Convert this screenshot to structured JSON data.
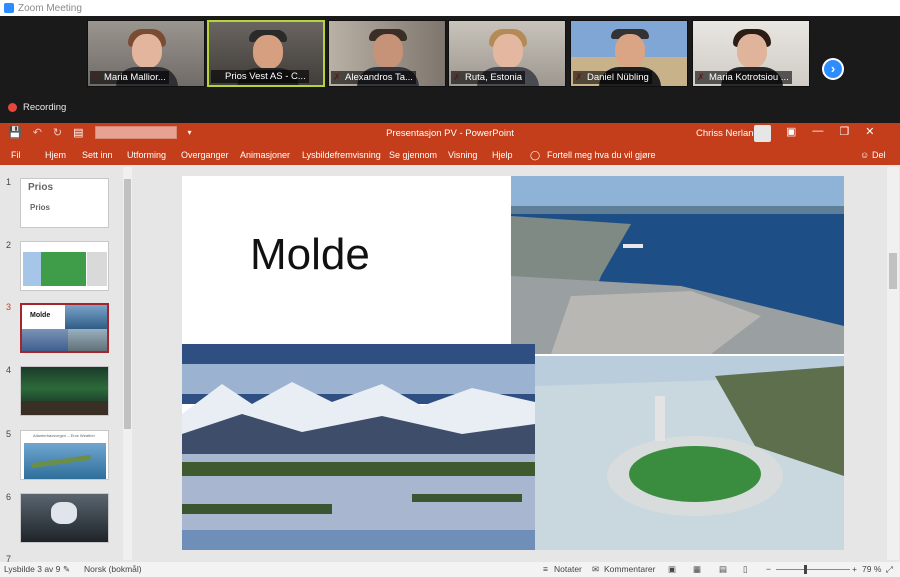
{
  "window": {
    "title": "Zoom Meeting"
  },
  "participants": [
    {
      "name": "Maria Mallior..."
    },
    {
      "name": "Prios Vest AS - C..."
    },
    {
      "name": "Alexandros Ta..."
    },
    {
      "name": "Ruta, Estonia"
    },
    {
      "name": "Daniel Nübling"
    },
    {
      "name": "Maria Kotrotsiou ..."
    }
  ],
  "recording": {
    "label": "Recording"
  },
  "ppt": {
    "doc_title": "Presentasjon PV  -  PowerPoint",
    "user": "Chriss Nerland",
    "tabs": [
      "Fil",
      "Hjem",
      "Sett inn",
      "Utforming",
      "Overganger",
      "Animasjoner",
      "Lysbildefremvisning",
      "Se gjennom",
      "Visning",
      "Hjelp",
      "Fortell meg hva du vil gjøre",
      "Del"
    ],
    "slide_numbers": [
      "1",
      "2",
      "3",
      "4",
      "5",
      "6",
      "7"
    ],
    "thumb1_text": [
      "Prios",
      "Prios"
    ],
    "thumb3_text": "Molde",
    "thumb5_text": "Atlanterhavsvegen – Eros Weather",
    "slide_title": "Molde"
  },
  "status": {
    "slide_info": "Lysbilde 3 av 9",
    "language": "Norsk (bokmål)",
    "notes": "Notater",
    "comments": "Kommentarer",
    "zoom": "79 %"
  },
  "colors": {
    "ppt_accent": "#c43e1c",
    "zoom_blue": "#2d8cff",
    "recording_red": "#e8463a"
  }
}
